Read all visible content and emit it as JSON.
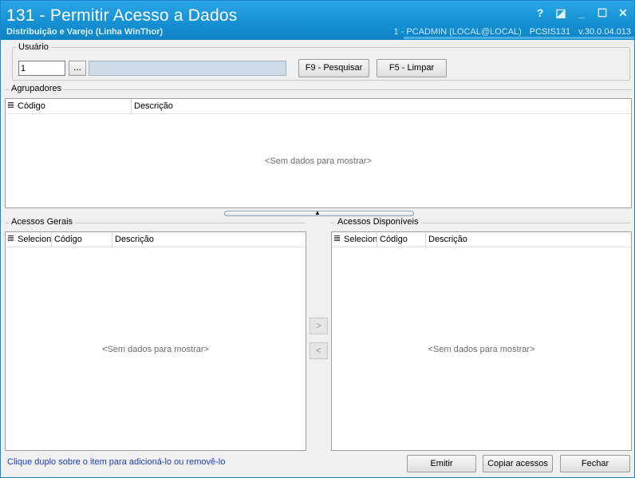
{
  "window": {
    "title": "131 - Permitir Acesso a Dados",
    "subtitle": "Distribuição e Varejo (Linha WinThor)",
    "session": "1 - PCADMIN (LOCAL@LOCAL)",
    "module": "PCSIS131",
    "version": "v.30.0.04.013",
    "controls": {
      "help": "?",
      "restore": "◪",
      "minimize": "_",
      "maximize": "☐",
      "close": "✕"
    }
  },
  "usuario": {
    "label": "Usuário",
    "code_value": "1",
    "lookup_label": "...",
    "name_value": "",
    "search_button": "F9 - Pesquisar",
    "clear_button": "F5 - Limpar"
  },
  "agrupadores": {
    "label": "Agrupadores",
    "columns": [
      "Código",
      "Descrição"
    ],
    "empty_text": "<Sem dados para mostrar>"
  },
  "acessos_gerais": {
    "label": "Acessos Gerais",
    "columns": [
      "Seleciona",
      "Código",
      "Descrição"
    ],
    "empty_text": "<Sem dados para mostrar>"
  },
  "acessos_disponiveis": {
    "label": "Acessos Disponíveis",
    "columns": [
      "Selecion",
      "Código",
      "Descrição"
    ],
    "empty_text": "<Sem dados para mostrar>"
  },
  "transfer": {
    "add": ">",
    "remove": "<"
  },
  "footer": {
    "hint": "Clique duplo sobre o item para adicioná-lo ou removê-lo",
    "emitir": "Emitir",
    "copiar": "Copiar acessos",
    "fechar": "Fechar"
  },
  "colors": {
    "titlebar": "#1691d4",
    "hint_text": "#1d3ebd"
  },
  "icons": {
    "grid_menu": "column-chooser-icon",
    "splitter": "chevron-up-icon"
  }
}
